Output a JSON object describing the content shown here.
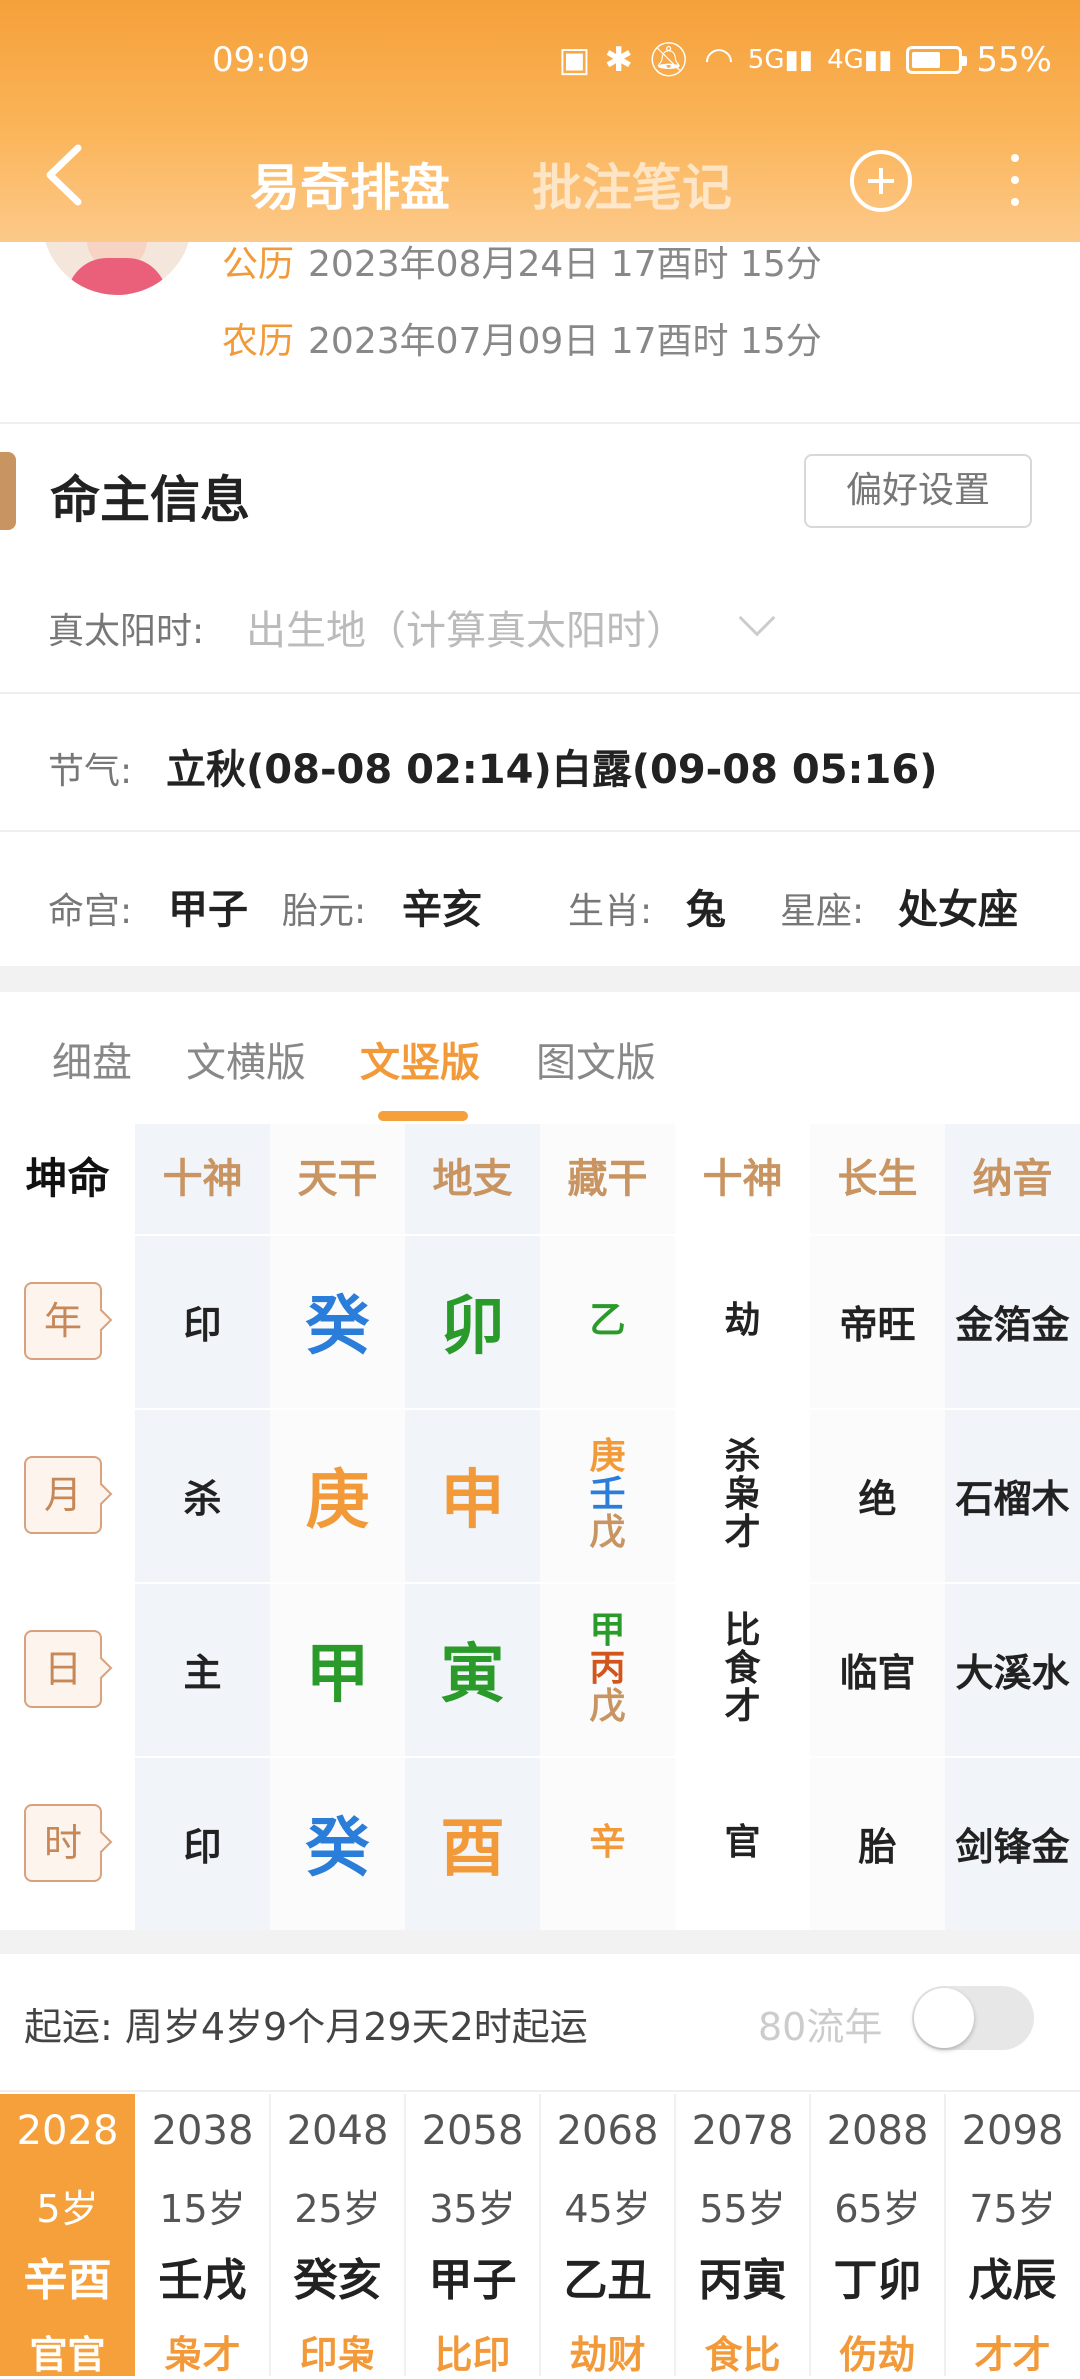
{
  "status_bar": {
    "time": "09:09",
    "icons": [
      "nfc-icon",
      "bluetooth-icon",
      "mute-icon",
      "wifi-icon",
      "5g-signal-icon",
      "4g-signal-icon"
    ],
    "battery": "55%",
    "battery_level": 0.55
  },
  "nav": {
    "tab_active": "易奇排盘",
    "tab_other": "批注笔记"
  },
  "dates": {
    "solar_label": "公历",
    "solar_value": "2023年08月24日 17酉时 15分",
    "lunar_label": "农历",
    "lunar_value": "2023年07月09日 17酉时 15分"
  },
  "info": {
    "title": "命主信息",
    "pref_button": "偏好设置",
    "solar_time_label": "真太阳时:",
    "solar_time_value": "出生地（计算真太阳时）",
    "jieqi_label": "节气:",
    "jieqi_value": "立秋(08-08 02:14)白露(09-08 05:16)",
    "minggong_label": "命宫:",
    "minggong_value": "甲子",
    "taiyuan_label": "胎元:",
    "taiyuan_value": "辛亥",
    "shengxiao_label": "生肖:",
    "shengxiao_value": "兔",
    "xingzuo_label": "星座:",
    "xingzuo_value": "处女座"
  },
  "view_tabs": [
    "细盘",
    "文横版",
    "文竖版",
    "图文版"
  ],
  "view_tab_active": "文竖版",
  "grid": {
    "corner": "坤命",
    "headers": [
      "十神",
      "天干",
      "地支",
      "藏干",
      "十神",
      "长生",
      "纳音"
    ],
    "rows": [
      {
        "pillar": "年",
        "shishen": "印",
        "tiangan": "癸",
        "dizhi": "卯",
        "canggan": [
          "乙"
        ],
        "shishen2": [
          "劫"
        ],
        "changsheng": "帝旺",
        "nayin": "金箔金"
      },
      {
        "pillar": "月",
        "shishen": "杀",
        "tiangan": "庚",
        "dizhi": "申",
        "canggan": [
          "庚",
          "壬",
          "戊"
        ],
        "shishen2": [
          "杀",
          "枭",
          "才"
        ],
        "changsheng": "绝",
        "nayin": "石榴木"
      },
      {
        "pillar": "日",
        "shishen": "主",
        "tiangan": "甲",
        "dizhi": "寅",
        "canggan": [
          "甲",
          "丙",
          "戊"
        ],
        "shishen2": [
          "比",
          "食",
          "才"
        ],
        "changsheng": "临官",
        "nayin": "大溪水"
      },
      {
        "pillar": "时",
        "shishen": "印",
        "tiangan": "癸",
        "dizhi": "酉",
        "canggan": [
          "辛"
        ],
        "shishen2": [
          "官"
        ],
        "changsheng": "胎",
        "nayin": "剑锋金"
      }
    ],
    "colors": {
      "wood": "#2a9a2a",
      "fire": "#d2561c",
      "earth": "#c89461",
      "metal": "#f29a3a",
      "water": "#2a7dd8"
    }
  },
  "start_luck": {
    "text": "起运:  周岁4岁9个月29天2时起运",
    "liunian_label": "80流年",
    "toggle_on": false
  },
  "dayun": [
    {
      "year": "2028",
      "age": "5岁",
      "ganzhi": "辛酉",
      "shishen": "官官",
      "active": true
    },
    {
      "year": "2038",
      "age": "15岁",
      "ganzhi": "壬戌",
      "shishen": "枭才"
    },
    {
      "year": "2048",
      "age": "25岁",
      "ganzhi": "癸亥",
      "shishen": "印枭"
    },
    {
      "year": "2058",
      "age": "35岁",
      "ganzhi": "甲子",
      "shishen": "比印"
    },
    {
      "year": "2068",
      "age": "45岁",
      "ganzhi": "乙丑",
      "shishen": "劫财"
    },
    {
      "year": "2078",
      "age": "55岁",
      "ganzhi": "丙寅",
      "shishen": "食比"
    },
    {
      "year": "2088",
      "age": "65岁",
      "ganzhi": "丁卯",
      "shishen": "伤劫"
    },
    {
      "year": "2098",
      "age": "75岁",
      "ganzhi": "戊辰",
      "shishen": "才才"
    }
  ]
}
